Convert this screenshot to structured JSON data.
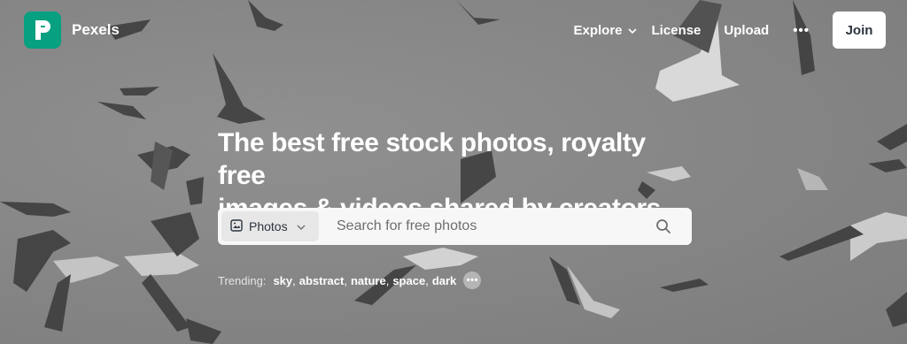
{
  "brand": {
    "name": "Pexels",
    "accent": "#07a081"
  },
  "nav": {
    "explore": "Explore",
    "license": "License",
    "upload": "Upload",
    "more": "•••",
    "join": "Join"
  },
  "hero": {
    "title_line1": "The best free stock photos, royalty free",
    "title_line2": "images & videos shared by creators."
  },
  "search": {
    "type_label": "Photos",
    "placeholder": "Search for free photos"
  },
  "trending": {
    "label": "Trending:",
    "items": [
      "sky",
      "abstract",
      "nature",
      "space",
      "dark"
    ],
    "more": "•••"
  },
  "icons": {
    "logo": "pexels-logo-icon",
    "explore_chevron": "chevron-down-icon",
    "photo_type": "image-icon",
    "search": "search-icon"
  }
}
